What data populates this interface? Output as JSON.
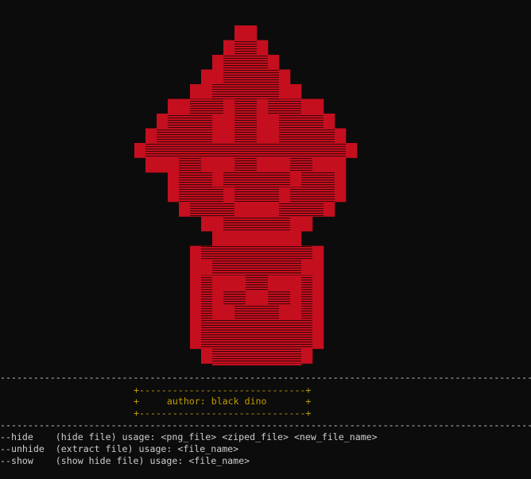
{
  "terminal": {
    "background_color": "#0c0c0c",
    "text_color": "#cccccc",
    "banner_color": "#c19c00",
    "art_color": "#c50f1f"
  },
  "separator_top": "--------------------------------------------------------------------------------------------------",
  "banner": {
    "border_top": "+------------------------------+",
    "author_line": "+     author: black dino       +",
    "border_bottom": "+------------------------------+"
  },
  "separator_bottom": "--------------------------------------------------------------------------------------------------",
  "usage": [
    "--hide    (hide file) usage: <png_file> <ziped_file> <new_file_name>",
    "--unhide  (extract file) usage: <file_name>",
    "--show    (show hide file) usage: <file_name>"
  ]
}
